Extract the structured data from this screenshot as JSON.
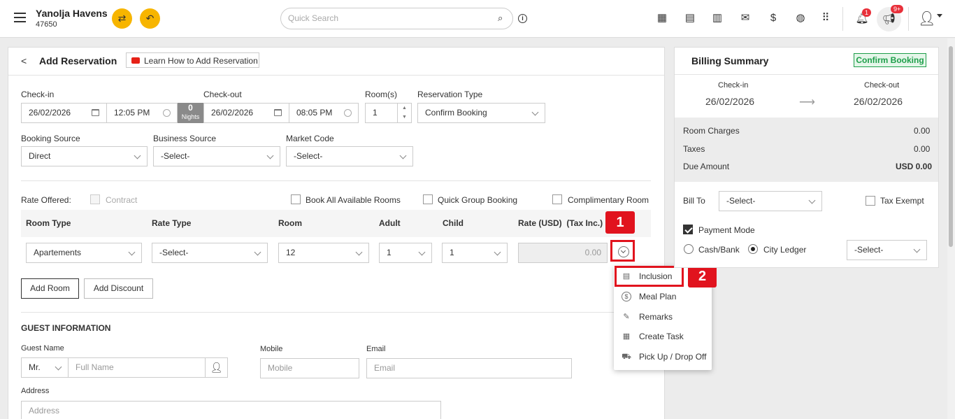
{
  "header": {
    "hotel_name": "Yanolja Havens",
    "hotel_id": "47650",
    "search_placeholder": "Quick Search",
    "notif_count": "1",
    "announce_count": "9+"
  },
  "form": {
    "title": "Add Reservation",
    "learn_link": "Learn How to Add Reservation",
    "checkin_label": "Check-in",
    "checkin_date": "26/02/2026",
    "checkin_time": "12:05 PM",
    "nights_count": "0",
    "nights_label": "Nights",
    "checkout_label": "Check-out",
    "checkout_date": "26/02/2026",
    "checkout_time": "08:05 PM",
    "rooms_label": "Room(s)",
    "rooms_value": "1",
    "res_type_label": "Reservation Type",
    "res_type_value": "Confirm Booking",
    "booking_source_label": "Booking Source",
    "booking_source_value": "Direct",
    "business_source_label": "Business Source",
    "business_source_value": "-Select-",
    "market_code_label": "Market Code",
    "market_code_value": "-Select-",
    "rate_offered_label": "Rate Offered:",
    "contract_label": "Contract",
    "book_all_label": "Book All Available Rooms",
    "quick_group_label": "Quick Group Booking",
    "complimentary_label": "Complimentary Room",
    "table_headers": [
      "Room Type",
      "Rate Type",
      "Room",
      "Adult",
      "Child",
      "Rate (USD)  (Tax Inc.)"
    ],
    "row": {
      "room_type": "Apartements",
      "rate_type": "-Select-",
      "room": "12",
      "adult": "1",
      "child": "1",
      "rate": "0.00"
    },
    "add_room": "Add Room",
    "add_discount": "Add Discount",
    "guest_info_title": "GUEST INFORMATION",
    "guest_name_label": "Guest Name",
    "salutation": "Mr.",
    "full_name_placeholder": "Full Name",
    "mobile_label": "Mobile",
    "mobile_placeholder": "Mobile",
    "email_label": "Email",
    "email_placeholder": "Email",
    "address_label": "Address",
    "address_placeholder": "Address"
  },
  "menu": {
    "items": [
      "Inclusion",
      "Meal Plan",
      "Remarks",
      "Create Task",
      "Pick Up / Drop Off"
    ]
  },
  "annotations": {
    "step1": "1",
    "step2": "2"
  },
  "billing": {
    "title": "Billing Summary",
    "status": "Confirm Booking",
    "checkin_label": "Check-in",
    "checkin_date": "26/02/2026",
    "checkout_label": "Check-out",
    "checkout_date": "26/02/2026",
    "room_charges_label": "Room Charges",
    "room_charges": "0.00",
    "taxes_label": "Taxes",
    "taxes": "0.00",
    "due_label": "Due Amount",
    "due": "USD 0.00",
    "bill_to_label": "Bill To",
    "bill_to_value": "-Select-",
    "tax_exempt_label": "Tax Exempt",
    "payment_mode_label": "Payment Mode",
    "cash_bank_label": "Cash/Bank",
    "city_ledger_label": "City Ledger",
    "ledger_select": "-Select-"
  },
  "colors": {
    "accent_yellow": "#f7b500",
    "annotation_red": "#e1131e",
    "confirm_green": "#1e9e4a",
    "badge_red": "#e8303a"
  }
}
